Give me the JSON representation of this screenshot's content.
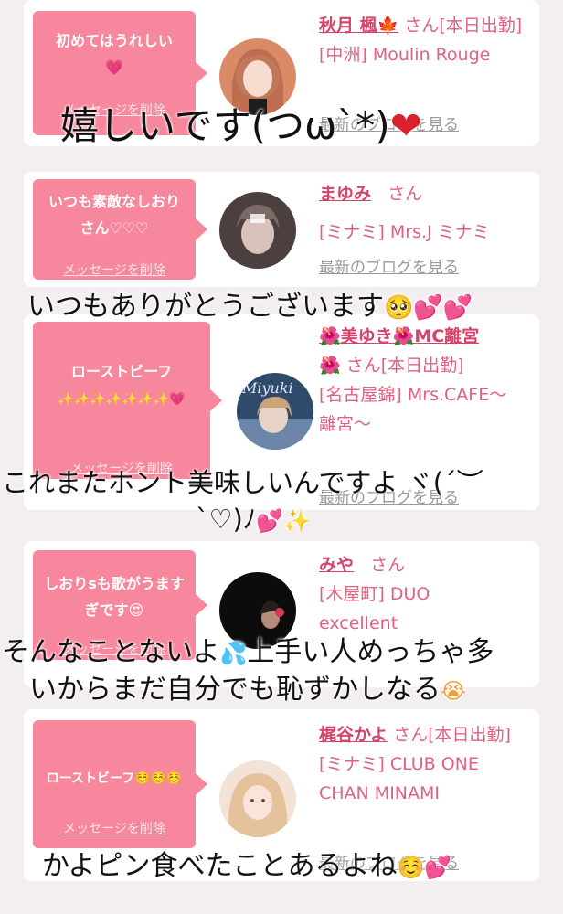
{
  "cards": [
    {
      "message": "初めてはうれしい",
      "message_emoji": "💗",
      "delete_label": "メッセージを削除",
      "name": "秋月 楓🍁",
      "honorific": "さん[本日出勤]",
      "shop": "[中洲] Moulin Rouge",
      "blog_label": "最新のブログを見る",
      "avatar_colors": [
        "#b8674a",
        "#f2d4c4"
      ]
    },
    {
      "message": "いつも素敵なしおりさん♡♡♡",
      "delete_label": "メッセージを削除",
      "name": "まゆみ",
      "honorific": "さん",
      "shop": "[ミナミ] Mrs.J ミナミ",
      "blog_label": "最新のブログを見る",
      "avatar_colors": [
        "#5c4a4a",
        "#d9c2bb"
      ]
    },
    {
      "message": "ローストビーフ",
      "message_emoji": "✨✨✨✨✨✨✨💗",
      "delete_label": "メッセージを削除",
      "name": "🌺美ゆき🌺MC離宮",
      "honorific": "🌺 さん[本日出勤]",
      "shop": "[名古屋錦] Mrs.CAFE〜離宮〜",
      "blog_label": "最新のブログを見る",
      "avatar_text": "Miyuki",
      "avatar_colors": [
        "#3d5f86",
        "#c6d4e6"
      ]
    },
    {
      "message": "しおりsも歌がうますぎです😍",
      "delete_label": "メッセージを削除",
      "name": "みや",
      "honorific": "さん",
      "shop": "[木屋町] DUO excellent",
      "blog_label": "最新のブログを見る",
      "avatar_colors": [
        "#0e0e0e",
        "#3a2f2f"
      ]
    },
    {
      "message": "ローストビーフ☺️☺️☺️",
      "delete_label": "メッセージを削除",
      "name": "梶谷かよ",
      "honorific": "さん[本日出勤]",
      "shop": "[ミナミ] CLUB ONE CHAN MINAMI",
      "blog_label": "最新のブログを見る",
      "avatar_colors": [
        "#e9c9b0",
        "#f7e7dc"
      ]
    }
  ],
  "overlays": {
    "t1": "嬉しいです(つω`*)",
    "t1_heart": "❤",
    "t2": "いつもありがとうございます",
    "t2_emoji": "🥺💕💕",
    "t3_line1": "これまたホント美味しいんですよ ヾ(´︶",
    "t3_line2": "`♡)ﾉ",
    "t3_emoji": "💕✨",
    "t4_line1a": "そんなことないよ",
    "t4_drop": "💦",
    "t4_line1b": "上手い人めっちゃ多",
    "t4_line2": "いからまだ自分でも恥ずかしなる",
    "t4_emoji": "😭",
    "t5": "かよピン食べたことあるよね",
    "t5_emoji": "☺️💕"
  }
}
